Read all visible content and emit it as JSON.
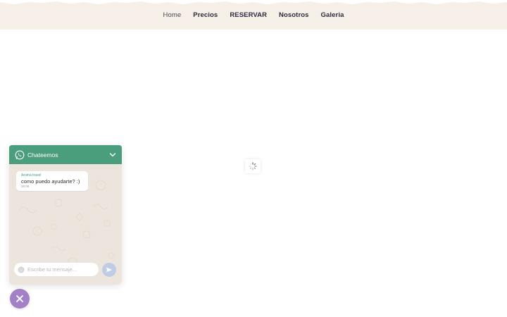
{
  "nav": {
    "items": [
      {
        "label": "Home",
        "active": true
      },
      {
        "label": "Precios",
        "active": false
      },
      {
        "label": "RESERVAR",
        "active": false
      },
      {
        "label": "Nosotros",
        "active": false
      },
      {
        "label": "Galeria",
        "active": false
      }
    ]
  },
  "chat": {
    "title": "Chateemos",
    "message": {
      "sender": "Arumá travel",
      "text": "como puedo ayudarte? :)",
      "time": "06:08"
    },
    "input": {
      "placeholder": "Escribe tu mensaje...",
      "value": ""
    }
  },
  "colors": {
    "header_bg": "#f6efe8",
    "chat_header": "#4a9e7b",
    "close_button": "#a381c6",
    "send_button": "#bfcde4"
  },
  "icons": {
    "chat_logo": "whatsapp-icon",
    "collapse": "chevron-down-icon",
    "emoji": "emoji-icon",
    "send": "send-icon",
    "close": "close-icon",
    "loading": "spinner-icon"
  }
}
